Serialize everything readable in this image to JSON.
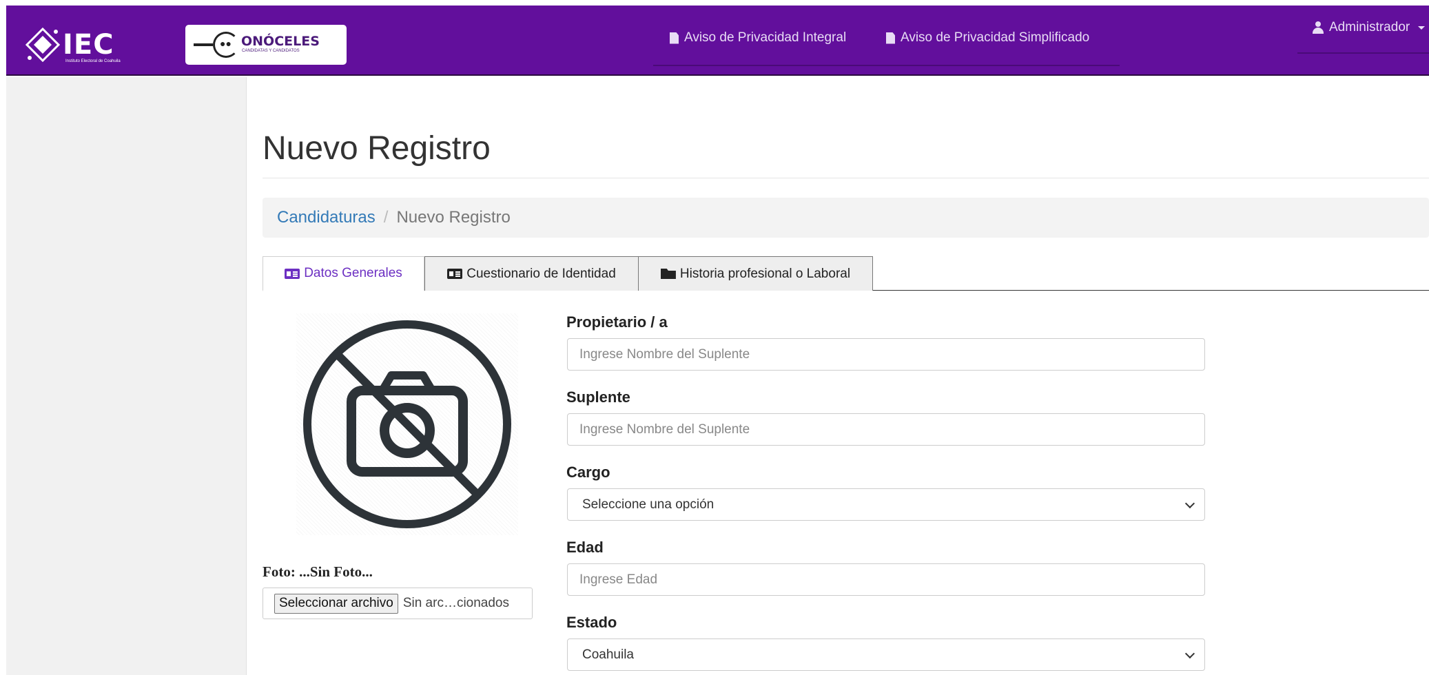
{
  "header": {
    "brand_iec": "IEC",
    "brand_iec_subtitle": "Instituto Electoral de Coahuila",
    "brand_app": "ONÓCELES",
    "brand_app_tagline": "CANDIDATAS Y CANDIDATOS",
    "nav_links": [
      {
        "label": "Aviso de Privacidad Integral",
        "icon": "file-icon"
      },
      {
        "label": "Aviso de Privacidad Simplificado",
        "icon": "file-icon"
      }
    ],
    "user_menu": {
      "label": "Administrador",
      "icon": "user-icon"
    }
  },
  "page": {
    "title": "Nuevo Registro",
    "breadcrumb": {
      "parent": "Candidaturas",
      "separator": "/",
      "current": "Nuevo Registro"
    }
  },
  "tabs": [
    {
      "label": "Datos Generales",
      "icon": "id-card-icon",
      "active": true
    },
    {
      "label": "Cuestionario de Identidad",
      "icon": "id-card-icon",
      "active": false
    },
    {
      "label": "Historia profesional o Laboral",
      "icon": "folder-open-icon",
      "active": false
    }
  ],
  "photo": {
    "label": "Foto: ...Sin Foto...",
    "file_button": "Seleccionar archivo",
    "file_status": "Sin arc…cionados",
    "placeholder_icon": "no-camera-icon"
  },
  "form": {
    "propietario": {
      "label": "Propietario / a",
      "placeholder": "Ingrese Nombre del Suplente"
    },
    "suplente": {
      "label": "Suplente",
      "placeholder": "Ingrese Nombre del Suplente"
    },
    "cargo": {
      "label": "Cargo",
      "value": "Seleccione una opción"
    },
    "edad": {
      "label": "Edad",
      "placeholder": "Ingrese Edad"
    },
    "estado": {
      "label": "Estado",
      "value": "Coahuila"
    }
  },
  "colors": {
    "navbar": "#620f9c",
    "active_tab_text": "#6c2fc2",
    "link": "#337ab7"
  }
}
